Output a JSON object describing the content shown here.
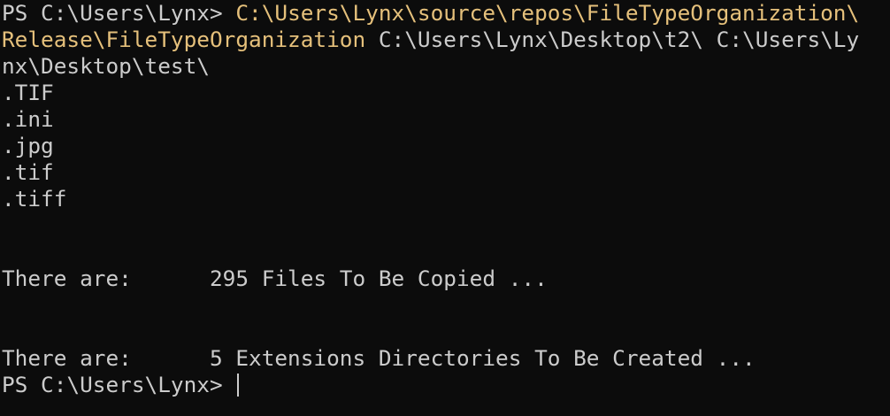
{
  "terminal": {
    "lines": {
      "l0_prompt": "PS C:\\Users\\Lynx> ",
      "l0_cmd": "C:\\Users\\Lynx\\source\\repos\\FileTypeOrganization\\",
      "l1_cmd": "Release\\FileTypeOrganization",
      "l1_args": " C:\\Users\\Lynx\\Desktop\\t2\\ C:\\Users\\Ly",
      "l2_args": "nx\\Desktop\\test\\",
      "ext_0": ".TIF",
      "ext_1": ".ini",
      "ext_2": ".jpg",
      "ext_3": ".tif",
      "ext_4": ".tiff",
      "files_label": "There are:      ",
      "files_msg": "295 Files To Be Copied ...",
      "dirs_label": "There are:      ",
      "dirs_msg": "5 Extensions Directories To Be Created ...",
      "final_prompt": "PS C:\\Users\\Lynx> "
    },
    "colors": {
      "background": "#0c0c0c",
      "foreground": "#cccccc",
      "command": "#e5c07b"
    }
  }
}
